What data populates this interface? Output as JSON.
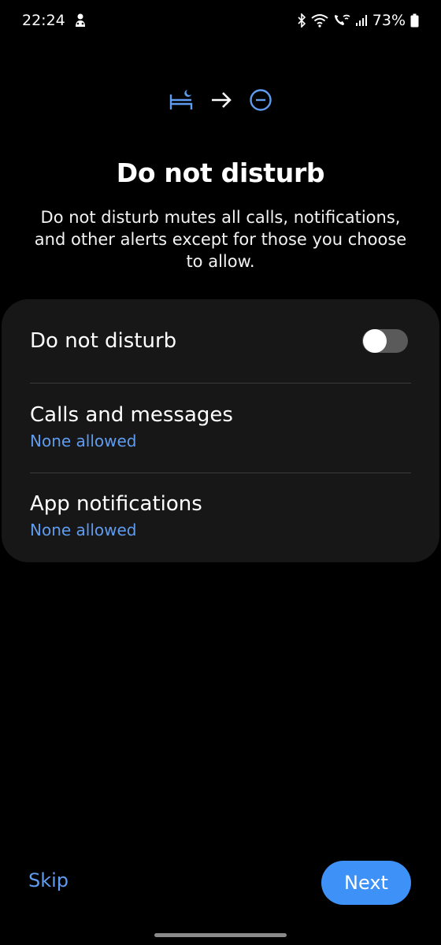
{
  "status_bar": {
    "time": "22:24",
    "battery": "73%",
    "icons": [
      "notification-icon",
      "bluetooth-icon",
      "wifi-icon",
      "wifi-calling-icon",
      "signal-icon",
      "battery-icon"
    ]
  },
  "header": {
    "icons": [
      "bedtime-icon",
      "arrow-right-icon",
      "do-not-disturb-icon"
    ],
    "title": "Do not disturb",
    "description": "Do not disturb mutes all calls, notifications, and other alerts except for those you choose to allow."
  },
  "settings": {
    "dnd": {
      "label": "Do not disturb",
      "enabled": false
    },
    "calls": {
      "label": "Calls and messages",
      "status": "None allowed"
    },
    "apps": {
      "label": "App notifications",
      "status": "None allowed"
    }
  },
  "footer": {
    "skip_label": "Skip",
    "next_label": "Next"
  },
  "colors": {
    "accent": "#5f9cf0",
    "primary_button": "#3e91f7",
    "card": "#171717",
    "background": "#000000"
  }
}
